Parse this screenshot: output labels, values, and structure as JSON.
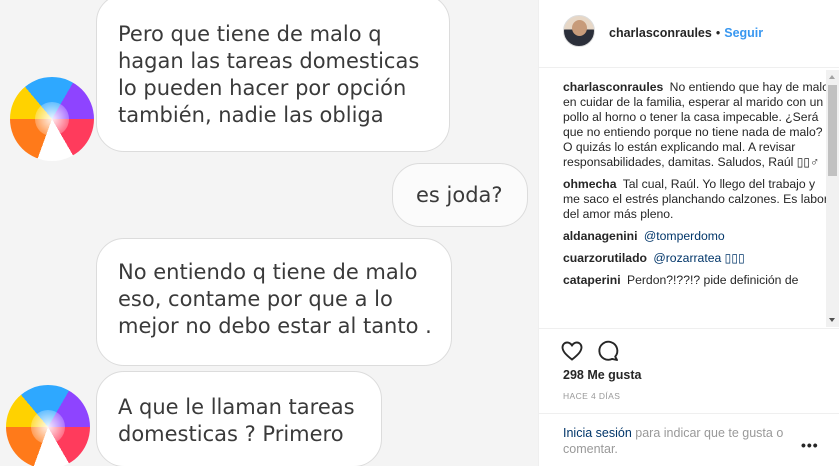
{
  "chat": {
    "messages": [
      {
        "side": "left",
        "text": "Pero que tiene de malo q\nhagan las tareas domesticas\nlo pueden hacer por opción\ntambién, nadie las obliga"
      },
      {
        "side": "right",
        "text": "es joda?"
      },
      {
        "side": "left",
        "text": "No entiendo q tiene de malo\neso, contame por que a lo\nmejor no debo estar al tanto ."
      },
      {
        "side": "left",
        "text": "A que le llaman tareas\ndomesticas ? Primero"
      }
    ]
  },
  "post": {
    "header": {
      "username": "charlasconraules",
      "separator": "•",
      "follow_label": "Seguir"
    },
    "comments": [
      {
        "user": "charlasconraules",
        "text": "No entiendo que hay de malo en cuidar de la familia, esperar al marido con un pollo al horno o tener la casa impecable. ¿Será que no entiendo porque no tiene nada de malo? O quizás lo están explicando mal. A revisar responsabilidades, damitas. Saludos, Raúl ▯▯♂"
      },
      {
        "user": "ohmecha",
        "text": "Tal cual, Raúl. Yo llego del trabajo y me saco el estrés planchando calzones. Es labor del amor más pleno."
      },
      {
        "user": "aldanagenini",
        "text": "@tomperdomo"
      },
      {
        "user": "cuarzorutilado",
        "text": "@rozarratea ▯▯▯"
      },
      {
        "user": "cataperini",
        "text": "Perdon?!??!? pide definición de"
      }
    ],
    "likes": "298 Me gusta",
    "timestamp": "HACE 4 DÍAS",
    "login": {
      "link": "Inicia sesión",
      "text": " para indicar que te gusta o comentar."
    },
    "more_label": "•••"
  },
  "icons": {
    "like": "heart-icon",
    "comment": "comment-bubble-icon",
    "more": "more-options-icon"
  },
  "colors": {
    "link_blue": "#3897f0",
    "mention_navy": "#003569",
    "muted_gray": "#999999"
  }
}
